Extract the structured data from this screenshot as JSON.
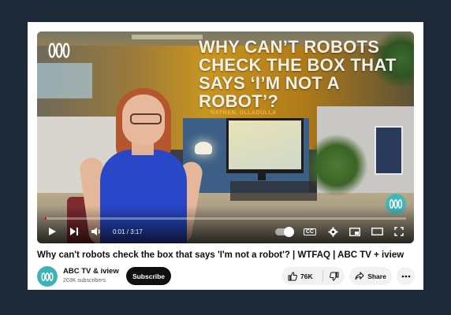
{
  "video": {
    "overlay_headline": "WHY CAN’T ROBOTS CHECK THE BOX THAT SAYS ‘I’M NOT A ROBOT’?",
    "overlay_location": "NATHAN, ULLADULLA",
    "progress_fraction": 0.005
  },
  "controls": {
    "time": "0:01 / 3:17",
    "cc_label": "CC",
    "icons": [
      "play-icon",
      "next-icon",
      "volume-icon",
      "autoplay-toggle",
      "captions-icon",
      "settings-icon",
      "miniplayer-icon",
      "theater-icon",
      "fullscreen-icon"
    ]
  },
  "title": "Why can't robots check the box that says 'I'm not a robot'? | WTFAQ | ABC TV + iview",
  "channel": {
    "name": "ABC TV & iview",
    "subscribers": "203K subscribers",
    "subscribe_label": "Subscribe"
  },
  "actions": {
    "likes": "76K",
    "share_label": "Share"
  },
  "colors": {
    "page_background": "#1f2a38",
    "progress": "#ff0000",
    "abc_teal": "#3fb2b5",
    "subscribe_bg": "#0f0f0f"
  }
}
